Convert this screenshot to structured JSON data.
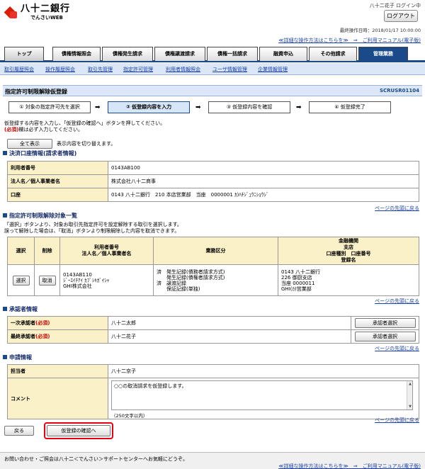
{
  "header": {
    "bank_name": "八十二銀行",
    "service_name": "でんさいWEB",
    "user": "八十二花子 ログイン中",
    "logout_label": "ログアウト",
    "last_operation": "最終操作日時：2018/01/17 10:00:00"
  },
  "help_link": "≪詳細な操作方法はこちらを≫　⇒　ご利用マニュアル(電子版)",
  "tabs": [
    "トップ",
    "債権情報照会",
    "債権発生請求",
    "債権譲渡請求",
    "債権一括請求",
    "融資申込",
    "その他請求",
    "管理業務"
  ],
  "subnav": [
    "取引履歴照会",
    "操作履歴照会",
    "取引先管理",
    "指定許可管理",
    "利用者情報照会",
    "ユーザ情報管理",
    "企業情報管理"
  ],
  "page": {
    "title": "指定許可制限解除仮登録",
    "screen_code": "SCRUSR01104"
  },
  "steps": [
    "① 対象の指定許可先を選択",
    "② 仮登録内容を入力",
    "③ 仮登録内容を確認",
    "④ 仮登録完了"
  ],
  "instructions": {
    "line1": "仮登録する内容を入力し、「仮登録の確認へ」ボタンを押してください。",
    "req_mark": "(必須)",
    "line2": "欄は必ず入力してください。"
  },
  "show_all": {
    "button": "全て表示",
    "text": "表示内容を切り替えます。"
  },
  "settlement": {
    "heading": "決済口座情報(請求者情報)",
    "rows": [
      {
        "label": "利用者番号",
        "value": "0143AB100"
      },
      {
        "label": "法人名／個人事業者名",
        "value": "株式会社八十二商事"
      },
      {
        "label": "口座",
        "value": "0143 八十二銀行　210 本店営業部　当座　0000001 ｶ)ﾊﾁｼﾞｭｳﾆｼｮｳｼﾞ"
      }
    ]
  },
  "page_top": "ページの先頭に戻る",
  "targets": {
    "heading": "指定許可制限解除対象一覧",
    "note1": "「選択」ボタンより、対象お取引先指定許可を設定解除する取引を選択します。",
    "note2": "誤って解除した場合は、「取消」ボタンより制限解除した内容を取消できます。",
    "cols": {
      "select": "選択",
      "delete": "削除",
      "user": "利用者番号\n法人名／個人事業者名",
      "category": "業務区分",
      "bank": "金融機関\n支店\n口座種別　口座番号\n登録名"
    },
    "row": {
      "select_btn": "選択",
      "cancel_btn": "取消",
      "user_no": "0143AB110",
      "user_kana": "ｼﾞｰｴｲﾁｱｲ ｶﾌﾞｼｷｶﾞｲｼｬ",
      "user_name": "GHI株式会社",
      "cat_mark1": "済",
      "cat_mark2": "済",
      "cat1": "発生記録(債務者請求方式)",
      "cat2": "発生記録(債権者請求方式)",
      "cat3": "譲渡記録",
      "cat4": "保証記録(単独)",
      "bank1": "0143 八十二銀行",
      "bank2": "226 御厨支店",
      "bank3": "当座 0000011",
      "bank4": "GHI(ｶ)営業部"
    }
  },
  "approver": {
    "heading": "承認者情報",
    "rows": [
      {
        "label": "一次承認者",
        "value": "八十二太郎",
        "btn": "承認者選択"
      },
      {
        "label": "最終承認者",
        "value": "八十二花子",
        "btn": "承認者選択"
      }
    ]
  },
  "request": {
    "heading": "申請情報",
    "person_label": "担当者",
    "person_value": "八十二京子",
    "comment_label": "コメント",
    "comment_value": "○○の取消請求を仮登録します。",
    "comment_limit": "（250文字以内）"
  },
  "buttons": {
    "back": "戻る",
    "confirm": "仮登録の確認へ"
  },
  "footer": {
    "text": "お問い合わせ・ご照会は八十二＜でんさい＞サポートセンターへお気軽にどうぞ。"
  },
  "colors": {
    "accent": "#1a4a8a",
    "label_bg": "#fbf1c9",
    "highlight": "#e60012"
  }
}
